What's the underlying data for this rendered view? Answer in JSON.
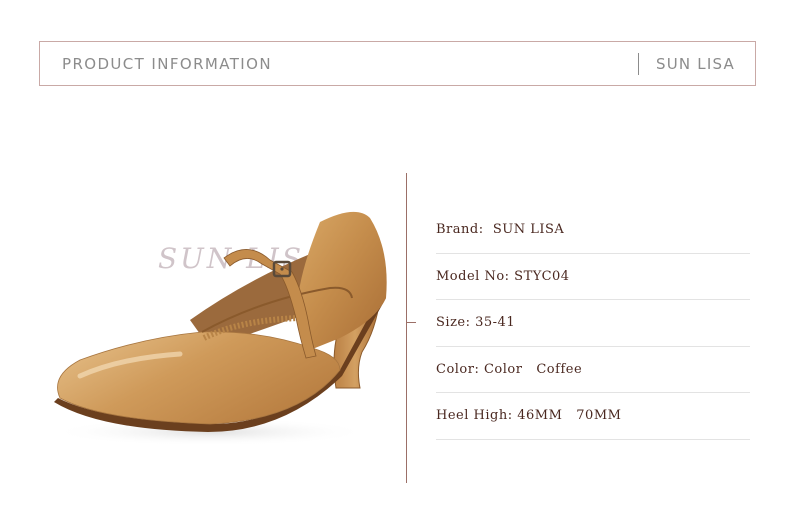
{
  "header": {
    "title": "PRODUCT INFORMATION",
    "brand": "SUN LISA"
  },
  "image": {
    "watermark": "SUN LISA",
    "shoe_color": "#c8924f"
  },
  "specs": [
    {
      "text": "Brand:  SUN LISA"
    },
    {
      "text": "Model No: STYC04"
    },
    {
      "text": "Size: 35-41"
    },
    {
      "text": "Color: Color   Coffee"
    },
    {
      "text": "Heel High: 46MM   70MM"
    }
  ],
  "colors": {
    "header_border": "#c9a9a6",
    "header_text": "#8c8c8c",
    "spec_text": "#4a2820",
    "vertical_line": "#9b6f67"
  }
}
